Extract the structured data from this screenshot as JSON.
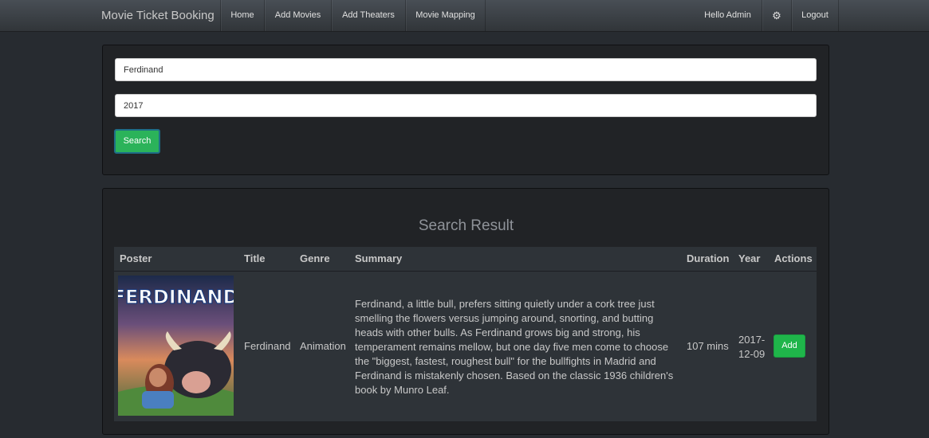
{
  "navbar": {
    "brand": "Movie Ticket Booking",
    "links": [
      "Home",
      "Add Movies",
      "Add Theaters",
      "Movie Mapping"
    ],
    "greeting": "Hello Admin",
    "settings_icon": "gear-icon",
    "logout": "Logout"
  },
  "search": {
    "title_value": "Ferdinand",
    "year_value": "2017",
    "button": "Search"
  },
  "results": {
    "heading": "Search Result",
    "columns": [
      "Poster",
      "Title",
      "Genre",
      "Summary",
      "Duration",
      "Year",
      "Actions"
    ],
    "rows": [
      {
        "poster_text": "FERDINAND",
        "title": "Ferdinand",
        "genre": "Animation",
        "summary_lines": [
          "Ferdinand, a little bull, prefers sitting quietly under a cork tree just",
          "smelling the flowers versus jumping around, snorting, and butting",
          "heads with other bulls. As Ferdinand grows big and strong, his",
          "temperament remains mellow, but one day five men come to choose",
          "the \"biggest, fastest, roughest bull\" for the bullfights in Madrid and",
          "Ferdinand is mistakenly chosen. Based on the classic 1936 children's",
          "book by Munro Leaf."
        ],
        "duration": "107 mins",
        "year_lines": [
          "2017-",
          "12-09"
        ],
        "action": "Add"
      }
    ]
  },
  "colors": {
    "background": "#272b30",
    "panel": "#212326",
    "table": "#2e3338",
    "success": "#1fb54a"
  }
}
